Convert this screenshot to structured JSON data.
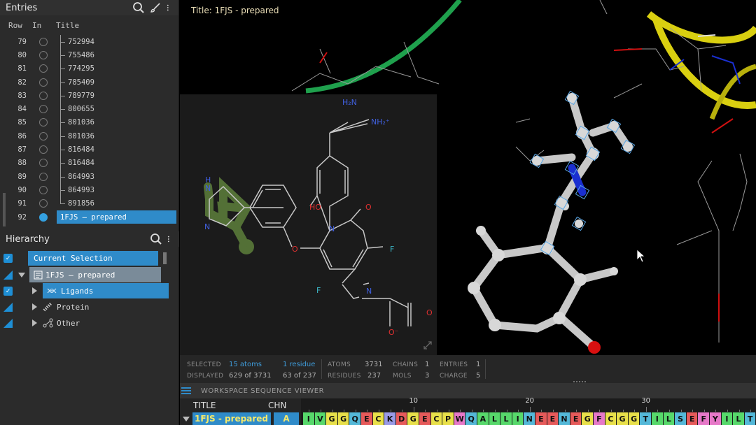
{
  "entries": {
    "title": "Entries",
    "columns": {
      "row": "Row",
      "in": "In",
      "title": "Title"
    },
    "rows": [
      {
        "row": "79",
        "title": "752994"
      },
      {
        "row": "80",
        "title": "755486"
      },
      {
        "row": "81",
        "title": "774295"
      },
      {
        "row": "82",
        "title": "785409"
      },
      {
        "row": "83",
        "title": "789779"
      },
      {
        "row": "84",
        "title": "800655"
      },
      {
        "row": "85",
        "title": "801036"
      },
      {
        "row": "86",
        "title": "801036"
      },
      {
        "row": "87",
        "title": "816484"
      },
      {
        "row": "88",
        "title": "816484"
      },
      {
        "row": "89",
        "title": "864993"
      },
      {
        "row": "90",
        "title": "864993"
      },
      {
        "row": "91",
        "title": "891856"
      },
      {
        "row": "92",
        "title": "1FJS – prepared"
      }
    ]
  },
  "hierarchy": {
    "title": "Hierarchy",
    "current_selection": "Current Selection",
    "entry": "1FJS – prepared",
    "ligands": "Ligands",
    "protein": "Protein",
    "other": "Other"
  },
  "viewport": {
    "title": "Title: 1FJS - prepared"
  },
  "ligand_2d": {
    "labels": {
      "h2n": "H₂N",
      "nh2": "NH₂⁺",
      "ho": "HO",
      "o1": "O",
      "o2": "O",
      "n_pyr": "N",
      "f1": "F",
      "f2": "F",
      "n_amine": "N",
      "o3": "O",
      "o4": "O⁻",
      "nh_top": "H",
      "n_top": "N",
      "n_bot": "N"
    }
  },
  "status": {
    "selected_label": "SELECTED",
    "selected_atoms": "15 atoms",
    "selected_residues": "1 residue",
    "displayed_label": "DISPLAYED",
    "displayed_atoms": "629 of 3731",
    "displayed_residues": "63 of 237",
    "atoms_label": "ATOMS",
    "atoms_value": "3731",
    "residues_label": "RESIDUES",
    "residues_value": "237",
    "chains_label": "CHAINS",
    "chains_value": "1",
    "mols_label": "MOLS",
    "mols_value": "3",
    "entries_label": "ENTRIES",
    "entries_value": "1",
    "charge_label": "CHARGE",
    "charge_value": "5"
  },
  "sequence": {
    "header": "WORKSPACE SEQUENCE VIEWER",
    "title_col": "TITLE",
    "chain_col": "CHN",
    "entry_title": "1FJS - prepared",
    "chain": "A",
    "ruler": [
      "10",
      "20",
      "30"
    ],
    "residues": [
      "I",
      "V",
      "G",
      "G",
      "Q",
      "E",
      "C",
      "K",
      "D",
      "G",
      "E",
      "C",
      "P",
      "W",
      "Q",
      "A",
      "L",
      "L",
      "I",
      "N",
      "E",
      "E",
      "N",
      "E",
      "G",
      "F",
      "C",
      "G",
      "G",
      "T",
      "I",
      "L",
      "S",
      "E",
      "F",
      "Y",
      "I",
      "L",
      "T"
    ],
    "colors": {
      "hydrophobic": "#57d86b",
      "polar": "#54b8d8",
      "negative": "#e65a5a",
      "positive": "#9a9ae6",
      "special": "#e8e04a",
      "aromatic": "#e678c8",
      "other": "#c0c0c0"
    }
  }
}
